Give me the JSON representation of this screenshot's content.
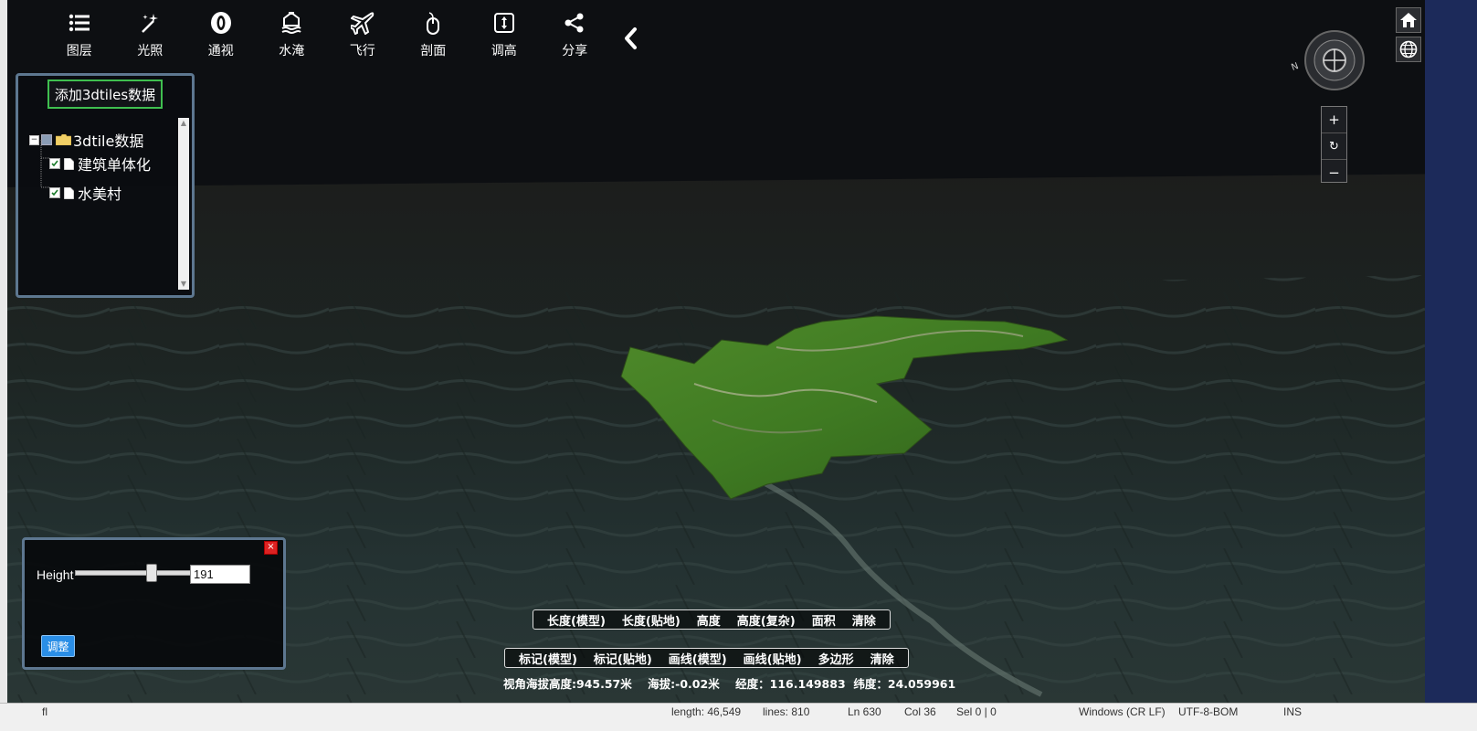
{
  "toolbar": {
    "items": [
      {
        "label": "图层",
        "icon": "list-icon"
      },
      {
        "label": "光照",
        "icon": "sparkle-wand-icon"
      },
      {
        "label": "通视",
        "icon": "eye-oval-icon"
      },
      {
        "label": "水淹",
        "icon": "flood-house-icon"
      },
      {
        "label": "飞行",
        "icon": "airplane-icon"
      },
      {
        "label": "剖面",
        "icon": "mouse-icon"
      },
      {
        "label": "调高",
        "icon": "height-adjust-icon"
      },
      {
        "label": "分享",
        "icon": "share-icon"
      }
    ],
    "collapse_icon": "chevron-left-icon"
  },
  "layer_panel": {
    "add_button": "添加3dtiles数据",
    "root": {
      "label": "3dtile数据",
      "expander": "−"
    },
    "children": [
      {
        "label": "建筑单体化",
        "checked": true
      },
      {
        "label": "水美村",
        "checked": true
      }
    ]
  },
  "height_panel": {
    "label": "Height",
    "value": "191",
    "slider_fraction": 0.66,
    "adjust_button": "调整",
    "close": "×"
  },
  "measure_bar_1": [
    "长度(模型)",
    "长度(贴地)",
    "高度",
    "高度(复杂)",
    "面积",
    "清除"
  ],
  "measure_bar_2": [
    "标记(模型)",
    "标记(贴地)",
    "画线(模型)",
    "画线(贴地)",
    "多边形",
    "清除"
  ],
  "status": {
    "view_height": "视角海拔高度:945.57米",
    "elevation": "海拔:-0.02米",
    "longitude": "经度：116.149883",
    "latitude": "纬度：24.059961"
  },
  "nav": {
    "zoom_in": "+",
    "reset": "↻",
    "zoom_out": "−",
    "compass_north": "N"
  },
  "bottom_bar": {
    "left": "fl",
    "line": "Ln 630",
    "col": "Col 36",
    "sel": "Sel 0 | 0",
    "line_ending": "Windows (CR LF)",
    "encoding": "UTF-8-BOM",
    "mode": "INS",
    "length": "length: 46,549",
    "lines": "lines: 810"
  },
  "colors": {
    "panel_border": "#5d7790",
    "add_button_border": "#3fbf4f",
    "adjust_button": "#2a8ee6",
    "close_button": "#dd2222"
  }
}
